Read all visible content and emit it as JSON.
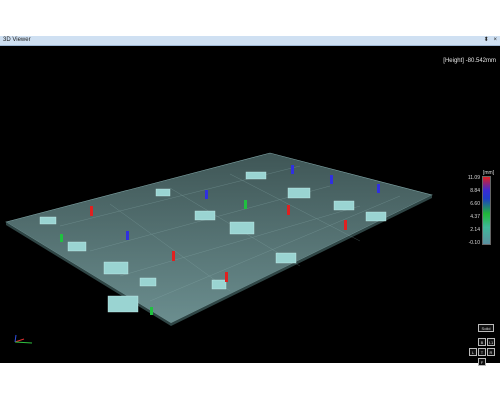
{
  "window": {
    "title": "3D Viewer",
    "pin_label": "⬍",
    "close_label": "×"
  },
  "readout": {
    "text": "[Height] -80.542mm"
  },
  "scale": {
    "unit": "[mm]",
    "labels": [
      "11.09",
      "8.84",
      "6.60",
      "4.37",
      "2.14",
      "-0.10"
    ]
  },
  "view_controls": {
    "solid_label": "Solid",
    "buttons": [
      "B",
      "I.1",
      "L",
      "T",
      "R",
      "F"
    ]
  },
  "colors": {
    "background": "#000000",
    "board": "#5e7f80",
    "titlebar": "#cfe0f2"
  }
}
